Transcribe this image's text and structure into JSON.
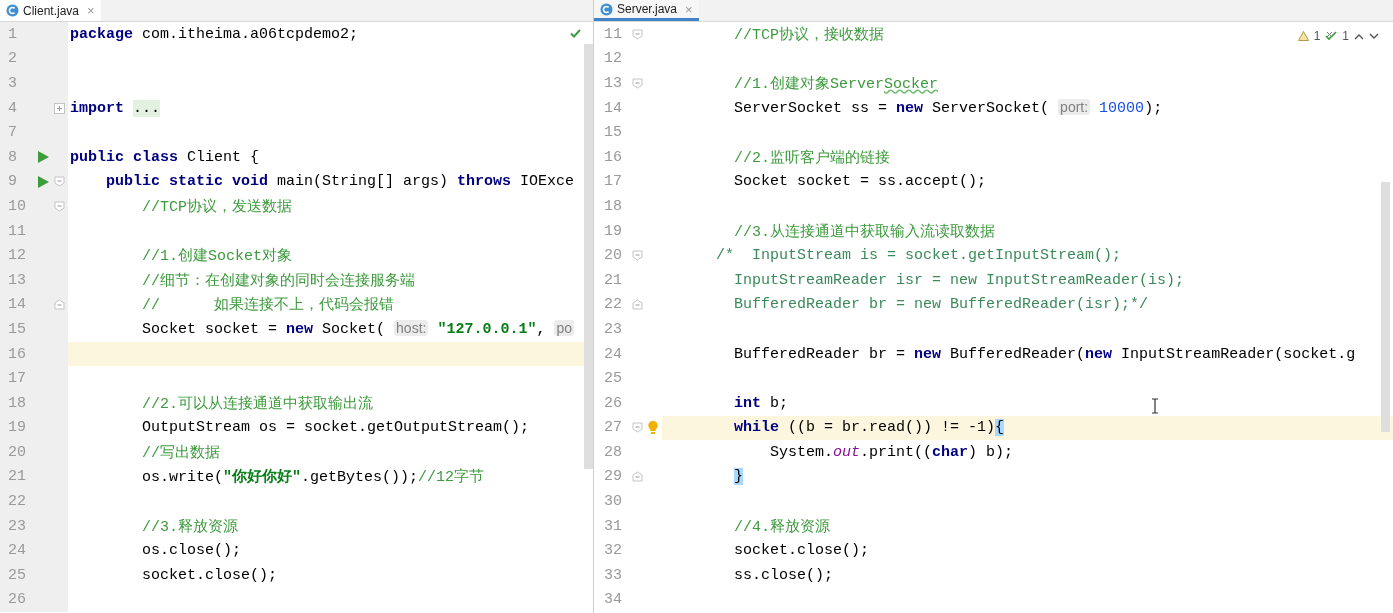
{
  "panes": [
    {
      "tab": {
        "title": "Client.java",
        "close": "×",
        "selected": false
      },
      "status": {
        "kind": "ok"
      },
      "lines": [
        {
          "number": "1",
          "current": false,
          "tokens": [
            {
              "kind": "kw",
              "text": "package"
            },
            {
              "kind": "plain",
              "text": " com.itheima.a06tcpdemo2;"
            }
          ]
        },
        {
          "number": "2",
          "current": false
        },
        {
          "number": "3",
          "current": false
        },
        {
          "number": "4",
          "current": false,
          "fold": {
            "kind": "collapsed"
          },
          "tokens": [
            {
              "kind": "kw",
              "text": "import"
            },
            {
              "kind": "folded",
              "text": "..."
            }
          ]
        },
        {
          "number": "7",
          "current": false
        },
        {
          "number": "8",
          "current": false,
          "marker": {
            "kind": "run"
          },
          "tokens": [
            {
              "kind": "kw",
              "text": "public class"
            },
            {
              "kind": "plain",
              "text": " Client {"
            }
          ]
        },
        {
          "number": "9",
          "current": false,
          "marker": {
            "kind": "run"
          },
          "fold": {
            "kind": "open"
          },
          "tokens": [
            {
              "kind": "kw",
              "text": "    public static void"
            },
            {
              "kind": "plain",
              "text": " main(String[] args) "
            },
            {
              "kind": "kw",
              "text": "throws"
            },
            {
              "kind": "plain",
              "text": " IOExce"
            }
          ]
        },
        {
          "number": "10",
          "current": false,
          "fold": {
            "kind": "open"
          },
          "tokens": [
            {
              "kind": "comment",
              "text": "        //TCP协议，发送数据"
            }
          ]
        },
        {
          "number": "11",
          "current": false
        },
        {
          "number": "12",
          "current": false,
          "tokens": [
            {
              "kind": "comment",
              "text": "        //1.创建Socket对象"
            }
          ]
        },
        {
          "number": "13",
          "current": false,
          "tokens": [
            {
              "kind": "comment",
              "text": "        //细节：在创建对象的同时会连接服务端"
            }
          ]
        },
        {
          "number": "14",
          "current": false,
          "fold": {
            "kind": "close"
          },
          "tokens": [
            {
              "kind": "comment",
              "text": "        //      如果连接不上，代码会报错"
            }
          ]
        },
        {
          "number": "15",
          "current": false,
          "tokens": [
            {
              "kind": "plain",
              "text": "        Socket socket = "
            },
            {
              "kind": "kw",
              "text": "new"
            },
            {
              "kind": "plain",
              "text": " Socket( "
            },
            {
              "kind": "hint",
              "text": "host:"
            },
            {
              "kind": "str",
              "text": " \"127.0.0.1\""
            },
            {
              "kind": "plain",
              "text": ", "
            },
            {
              "kind": "hint",
              "text": "po"
            }
          ]
        },
        {
          "number": "16",
          "current": true
        },
        {
          "number": "17",
          "current": false
        },
        {
          "number": "18",
          "current": false,
          "tokens": [
            {
              "kind": "comment",
              "text": "        //2.可以从连接通道中获取输出流"
            }
          ]
        },
        {
          "number": "19",
          "current": false,
          "tokens": [
            {
              "kind": "plain",
              "text": "        OutputStream os = socket.getOutputStream();"
            }
          ]
        },
        {
          "number": "20",
          "current": false,
          "tokens": [
            {
              "kind": "comment",
              "text": "        //写出数据"
            }
          ]
        },
        {
          "number": "21",
          "current": false,
          "tokens": [
            {
              "kind": "plain",
              "text": "        os.write("
            },
            {
              "kind": "str",
              "text": "\"你好你好\""
            },
            {
              "kind": "plain",
              "text": ".getBytes());"
            },
            {
              "kind": "comment",
              "text": "//12字节"
            }
          ]
        },
        {
          "number": "22",
          "current": false
        },
        {
          "number": "23",
          "current": false,
          "tokens": [
            {
              "kind": "comment",
              "text": "        //3.释放资源"
            }
          ]
        },
        {
          "number": "24",
          "current": false,
          "tokens": [
            {
              "kind": "plain",
              "text": "        os.close();"
            }
          ]
        },
        {
          "number": "25",
          "current": false,
          "tokens": [
            {
              "kind": "plain",
              "text": "        socket.close();"
            }
          ]
        },
        {
          "number": "26",
          "current": false
        }
      ]
    },
    {
      "tab": {
        "title": "Server.java",
        "close": "×",
        "selected": true
      },
      "status": {
        "kind": "counts",
        "warnings": "1",
        "typos": "1"
      },
      "lines": [
        {
          "number": "11",
          "current": false,
          "fold": {
            "kind": "open"
          },
          "tokens": [
            {
              "kind": "comment",
              "text": "        //TCP协议，接收数据"
            }
          ]
        },
        {
          "number": "12",
          "current": false
        },
        {
          "number": "13",
          "current": false,
          "fold": {
            "kind": "open"
          },
          "tokens": [
            {
              "kind": "comment",
              "text": "        //1.创建对象Server"
            },
            {
              "kind": "typo",
              "text": "Socker"
            }
          ]
        },
        {
          "number": "14",
          "current": false,
          "tokens": [
            {
              "kind": "plain",
              "text": "        ServerSocket ss = "
            },
            {
              "kind": "kw",
              "text": "new"
            },
            {
              "kind": "plain",
              "text": " ServerSocket( "
            },
            {
              "kind": "hint",
              "text": "port:"
            },
            {
              "kind": "num",
              "text": " 10000"
            },
            {
              "kind": "plain",
              "text": ");"
            }
          ]
        },
        {
          "number": "15",
          "current": false
        },
        {
          "number": "16",
          "current": false,
          "tokens": [
            {
              "kind": "comment",
              "text": "        //2.监听客户端的链接"
            }
          ]
        },
        {
          "number": "17",
          "current": false,
          "tokens": [
            {
              "kind": "plain",
              "text": "        Socket socket = ss.accept();"
            }
          ]
        },
        {
          "number": "18",
          "current": false
        },
        {
          "number": "19",
          "current": false,
          "tokens": [
            {
              "kind": "comment",
              "text": "        //3.从连接通道中获取输入流读取数据"
            }
          ]
        },
        {
          "number": "20",
          "current": false,
          "fold": {
            "kind": "open"
          },
          "tokens": [
            {
              "kind": "block",
              "text": "      /*  InputStream is = socket.getInputStream();"
            }
          ]
        },
        {
          "number": "21",
          "current": false,
          "tokens": [
            {
              "kind": "block",
              "text": "        InputStreamReader isr = new InputStreamReader(is);"
            }
          ]
        },
        {
          "number": "22",
          "current": false,
          "fold": {
            "kind": "close"
          },
          "tokens": [
            {
              "kind": "block",
              "text": "        BufferedReader br = new BufferedReader(isr);*/"
            }
          ]
        },
        {
          "number": "23",
          "current": false
        },
        {
          "number": "24",
          "current": false,
          "tokens": [
            {
              "kind": "plain",
              "text": "        BufferedReader br = "
            },
            {
              "kind": "kw",
              "text": "new"
            },
            {
              "kind": "plain",
              "text": " BufferedReader("
            },
            {
              "kind": "kw",
              "text": "new"
            },
            {
              "kind": "plain",
              "text": " InputStreamReader(socket.g"
            }
          ]
        },
        {
          "number": "25",
          "current": false
        },
        {
          "number": "26",
          "current": false,
          "tokens": [
            {
              "kind": "kw",
              "text": "        int"
            },
            {
              "kind": "plain",
              "text": " b;"
            }
          ]
        },
        {
          "number": "27",
          "current": true,
          "fold": {
            "kind": "open"
          },
          "marker": {
            "kind": "bulb"
          },
          "tokens": [
            {
              "kind": "kw",
              "text": "        while"
            },
            {
              "kind": "plain",
              "text": " ((b = br.read()) != -1)"
            },
            {
              "kind": "brace",
              "text": "{"
            }
          ]
        },
        {
          "number": "28",
          "current": false,
          "tokens": [
            {
              "kind": "plain",
              "text": "            System."
            },
            {
              "kind": "field",
              "text": "out"
            },
            {
              "kind": "plain",
              "text": ".print(("
            },
            {
              "kind": "kw",
              "text": "char"
            },
            {
              "kind": "plain",
              "text": ") b);"
            }
          ]
        },
        {
          "number": "29",
          "current": false,
          "fold": {
            "kind": "close"
          },
          "tokens": [
            {
              "kind": "brace",
              "text": "        }"
            }
          ]
        },
        {
          "number": "30",
          "current": false
        },
        {
          "number": "31",
          "current": false,
          "tokens": [
            {
              "kind": "comment",
              "text": "        //4.释放资源"
            }
          ]
        },
        {
          "number": "32",
          "current": false,
          "tokens": [
            {
              "kind": "plain",
              "text": "        socket.close();"
            }
          ]
        },
        {
          "number": "33",
          "current": false,
          "tokens": [
            {
              "kind": "plain",
              "text": "        ss.close();"
            }
          ]
        },
        {
          "number": "34",
          "current": false
        }
      ]
    }
  ]
}
